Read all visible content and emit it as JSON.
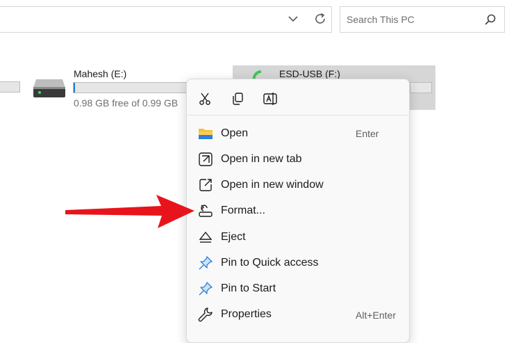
{
  "search": {
    "placeholder": "Search This PC"
  },
  "drives": [
    {
      "name": "Mahesh (E:)",
      "free_text": "0.98 GB free of 0.99 GB",
      "used_fraction": 0.01,
      "selected": false
    },
    {
      "name": "ESD-USB (F:)",
      "selected": true
    }
  ],
  "context_menu": {
    "quick_actions": [
      {
        "icon": "scissors-icon",
        "action": "cut"
      },
      {
        "icon": "copy-icon",
        "action": "copy"
      },
      {
        "icon": "rename-icon",
        "action": "rename"
      }
    ],
    "items": [
      {
        "label": "Open",
        "shortcut": "Enter",
        "icon": "folder-icon"
      },
      {
        "label": "Open in new tab",
        "shortcut": "",
        "icon": "new-tab-icon"
      },
      {
        "label": "Open in new window",
        "shortcut": "",
        "icon": "new-window-icon"
      },
      {
        "label": "Format...",
        "shortcut": "",
        "icon": "format-icon"
      },
      {
        "label": "Eject",
        "shortcut": "",
        "icon": "eject-icon"
      },
      {
        "label": "Pin to Quick access",
        "shortcut": "",
        "icon": "pin-icon"
      },
      {
        "label": "Pin to Start",
        "shortcut": "",
        "icon": "pin-icon"
      },
      {
        "label": "Properties",
        "shortcut": "Alt+Enter",
        "icon": "wrench-icon"
      }
    ]
  },
  "colors": {
    "accent": "#1e7ad6",
    "arrow": "#e8141b",
    "selected_drive_bg": "#d6d6d6",
    "menu_bg": "#f9f9f9",
    "folder_yellow": "#f4bf3a"
  }
}
